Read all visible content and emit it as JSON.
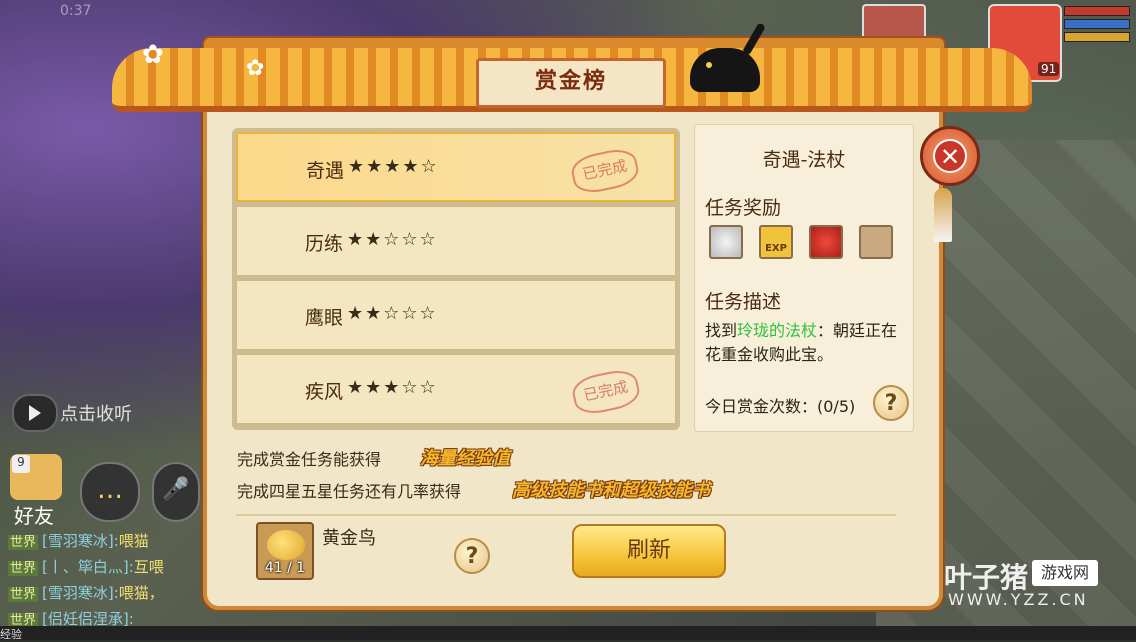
{
  "status_bar": {
    "time": "0:37"
  },
  "hud": {
    "level": "91"
  },
  "chat_panel": {
    "voice_label": "点击收听",
    "friend_label": "好友",
    "friend_count": "9",
    "lines": [
      {
        "channel": "世界",
        "name": "[雪羽寒冰]:",
        "message": "喂猫"
      },
      {
        "channel": "世界",
        "name": "[丨、筚白灬]:",
        "message": "互喂"
      },
      {
        "channel": "世界",
        "name": "[雪羽寒冰]:",
        "message": "喂猫，"
      },
      {
        "channel": "世界",
        "name": "[侣妊侣涅承]:",
        "message": ""
      }
    ],
    "exp_label": "经验"
  },
  "panel": {
    "title": "赏金榜",
    "tasks": [
      {
        "name": "奇遇",
        "stars": "★★★★☆",
        "completed": true,
        "selected": true
      },
      {
        "name": "历练",
        "stars": "★★☆☆☆",
        "completed": false,
        "selected": false
      },
      {
        "name": "鹰眼",
        "stars": "★★☆☆☆",
        "completed": false,
        "selected": false
      },
      {
        "name": "疾风",
        "stars": "★★★☆☆",
        "completed": true,
        "selected": false
      }
    ],
    "stamp_text": "已完成",
    "detail": {
      "title": "奇遇-法杖",
      "reward_heading": "任务奖励",
      "rewards": [
        "silver-coin-icon",
        "exp-icon",
        "red-pouch-icon",
        "empty-slot"
      ],
      "exp_text": "EXP",
      "desc_heading": "任务描述",
      "desc_prefix": "找到",
      "desc_highlight": "玲珑的法杖",
      "desc_suffix": "：朝廷正在花重金收购此宝。",
      "daily_count": "今日赏金次数：(0/5)",
      "help_symbol": "?"
    },
    "info_line1": "完成赏金任务能获得",
    "info_bold1": "海量经验值",
    "info_line2": "完成四星五星任务还有几率获得",
    "info_bold2": "高级技能书和超级技能书",
    "bird_name": "黄金鸟",
    "bird_count": "41 / 1",
    "refresh_label": "刷新",
    "close_symbol": "✕"
  },
  "watermark": {
    "main": "叶子猪",
    "box": "游戏网",
    "sub": "WWW.YZZ.CN"
  },
  "colors": {
    "accent": "#f4b72c",
    "highlight": "#2fc23c",
    "title": "#7a2b10"
  }
}
